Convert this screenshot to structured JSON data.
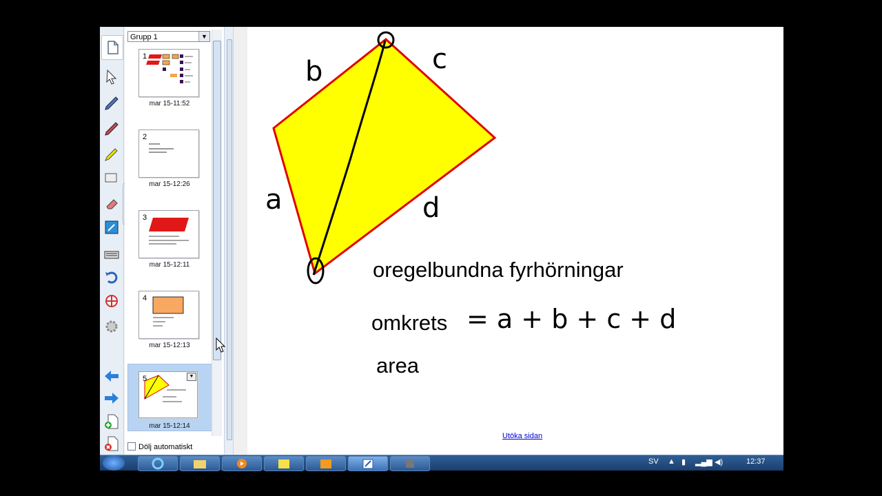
{
  "sorter": {
    "group_label": "Grupp 1",
    "pages": [
      {
        "num": "1",
        "time": "mar 15-11:52"
      },
      {
        "num": "2",
        "time": "mar 15-12:26"
      },
      {
        "num": "3",
        "time": "mar 15-12:11"
      },
      {
        "num": "4",
        "time": "mar 15-12:13"
      },
      {
        "num": "5",
        "time": "mar 15-12:14"
      }
    ],
    "auto_hide_label": "Dölj automatiskt"
  },
  "canvas": {
    "side_labels": {
      "a": "a",
      "b": "b",
      "c": "c",
      "d": "d"
    },
    "title": "oregelbundna fyrhörningar",
    "perimeter_word": "omkrets",
    "perimeter_formula": "= a + b + c + d",
    "area_word": "area",
    "extend_link": "Utöka sidan"
  },
  "taskbar": {
    "lang": "SV",
    "clock": "12:37"
  },
  "colors": {
    "shape_fill": "#ffff00",
    "shape_stroke": "#e00000",
    "selected_thumb_bg": "#b8d4f2"
  },
  "icons": [
    "page-sorter-icon",
    "select-arrow-icon",
    "pen-icon",
    "creative-pen-icon",
    "highlighter-icon",
    "shape-recognition-icon",
    "eraser-icon",
    "line-icon",
    "fill-icon",
    "text-icon",
    "keyboard-icon",
    "undo-icon",
    "move-icon",
    "properties-icon",
    "back-arrow-icon",
    "forward-arrow-icon",
    "add-page-icon",
    "delete-page-icon"
  ]
}
